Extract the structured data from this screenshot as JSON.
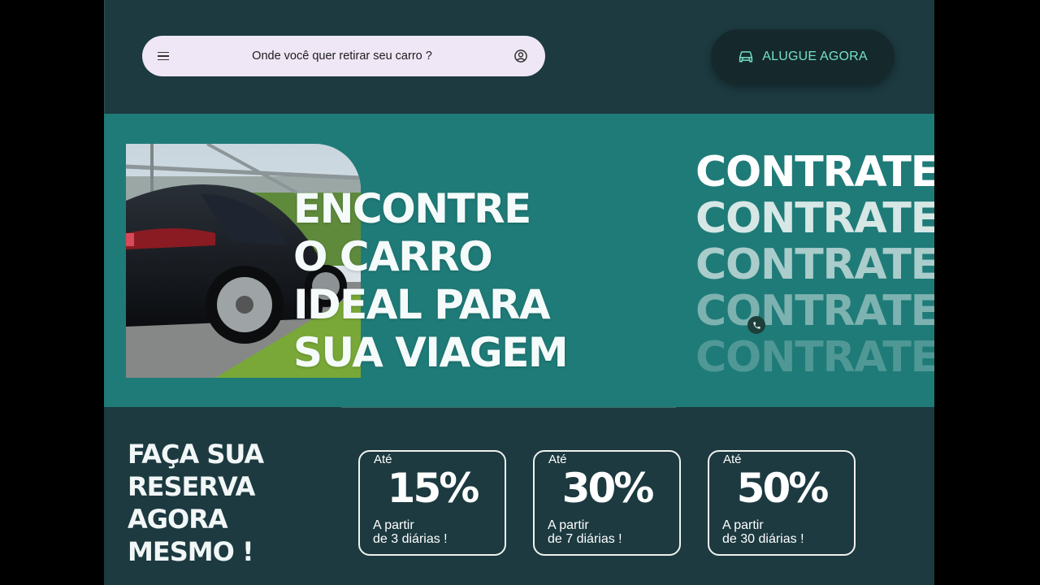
{
  "header": {
    "search": {
      "placeholder": "Onde você quer retirar seu carro ?",
      "menu_icon": "menu-icon",
      "account_icon": "account-circle-icon"
    },
    "rent_button": {
      "label": "ALUGUE AGORA",
      "icon": "car-icon"
    }
  },
  "hero": {
    "headline": [
      "ENCONTRE",
      "O CARRO",
      "IDEAL PARA",
      "SUA VIAGEM"
    ],
    "contrate": [
      "CONTRATE",
      "CONTRATE",
      "CONTRATE",
      "CONTRATE",
      "CONTRATE"
    ],
    "call_icon": "phone-icon"
  },
  "reserve": {
    "title": [
      "FAÇA SUA",
      "RESERVA",
      "AGORA",
      "MESMO !"
    ],
    "offers": [
      {
        "prefix": "Até",
        "percent": "15%",
        "line1": "A partir",
        "line2": "de 3 diárias !"
      },
      {
        "prefix": "Até",
        "percent": "30%",
        "line1": "A partir",
        "line2": "de 7 diárias !"
      },
      {
        "prefix": "Até",
        "percent": "50%",
        "line1": "A partir",
        "line2": "de 30 diárias !"
      }
    ]
  },
  "colors": {
    "header_bg": "#1c3a40",
    "hero_bg": "#1f7b78",
    "accent": "#76e0c9",
    "search_bg": "#efe7f5"
  }
}
